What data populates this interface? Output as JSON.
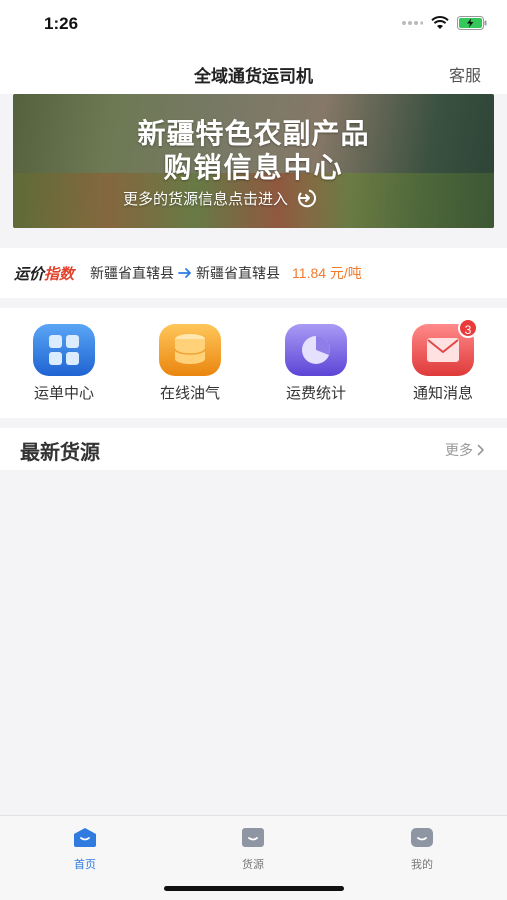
{
  "status": {
    "time": "1:26"
  },
  "nav": {
    "title": "全域通货运司机",
    "service_label": "客服"
  },
  "banner": {
    "line1": "新疆特色农副产品",
    "line2": "购销信息中心",
    "cta": "更多的货源信息点击进入"
  },
  "price_index": {
    "brand_part1": "运价",
    "brand_part2": "指数",
    "origin": "新疆省直辖县",
    "destination": "新疆省直辖县",
    "price": "11.84 元/吨"
  },
  "actions": [
    {
      "label": "运单中心",
      "icon": "grid-icon"
    },
    {
      "label": "在线油气",
      "icon": "fuel-tank-icon"
    },
    {
      "label": "运费统计",
      "icon": "pie-chart-icon"
    },
    {
      "label": "通知消息",
      "icon": "mail-icon",
      "badge": "3"
    }
  ],
  "section": {
    "title": "最新货源",
    "more": "更多"
  },
  "tabs": [
    {
      "label": "首页",
      "active": true
    },
    {
      "label": "货源",
      "active": false
    },
    {
      "label": "我的",
      "active": false
    }
  ],
  "colors": {
    "accent": "#2f7be0",
    "price": "#f07a2e",
    "index_red": "#e2432c",
    "badge": "#ea3b3b"
  }
}
